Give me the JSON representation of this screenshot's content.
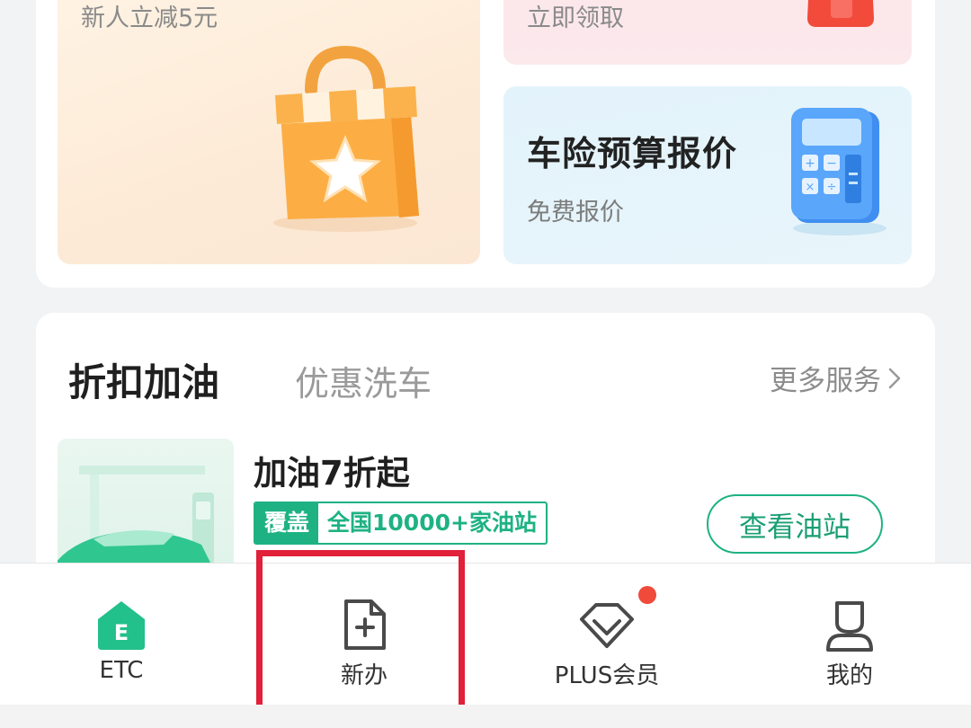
{
  "promo": {
    "left_subtitle": "新人立减5元",
    "right_top_subtitle": "立即领取",
    "right_bottom_title": "车险预算报价",
    "right_bottom_subtitle": "免费报价"
  },
  "services": {
    "tabs": [
      {
        "label": "折扣加油",
        "active": true
      },
      {
        "label": "优惠洗车",
        "active": false
      }
    ],
    "more_label": "更多服务",
    "fuel": {
      "title": "加油7折起",
      "tag": "覆盖",
      "coverage_text": "全国10000+家油站",
      "button_label": "查看油站"
    }
  },
  "tabbar": {
    "items": [
      {
        "label": "ETC",
        "icon": "etc-icon"
      },
      {
        "label": "新办",
        "icon": "new-document-icon"
      },
      {
        "label": "PLUS会员",
        "icon": "plus-diamond-icon"
      },
      {
        "label": "我的",
        "icon": "user-icon"
      }
    ]
  },
  "colors": {
    "accent_green": "#1eb283",
    "badge_red": "#f04a3a",
    "highlight_red": "#e1203a"
  }
}
